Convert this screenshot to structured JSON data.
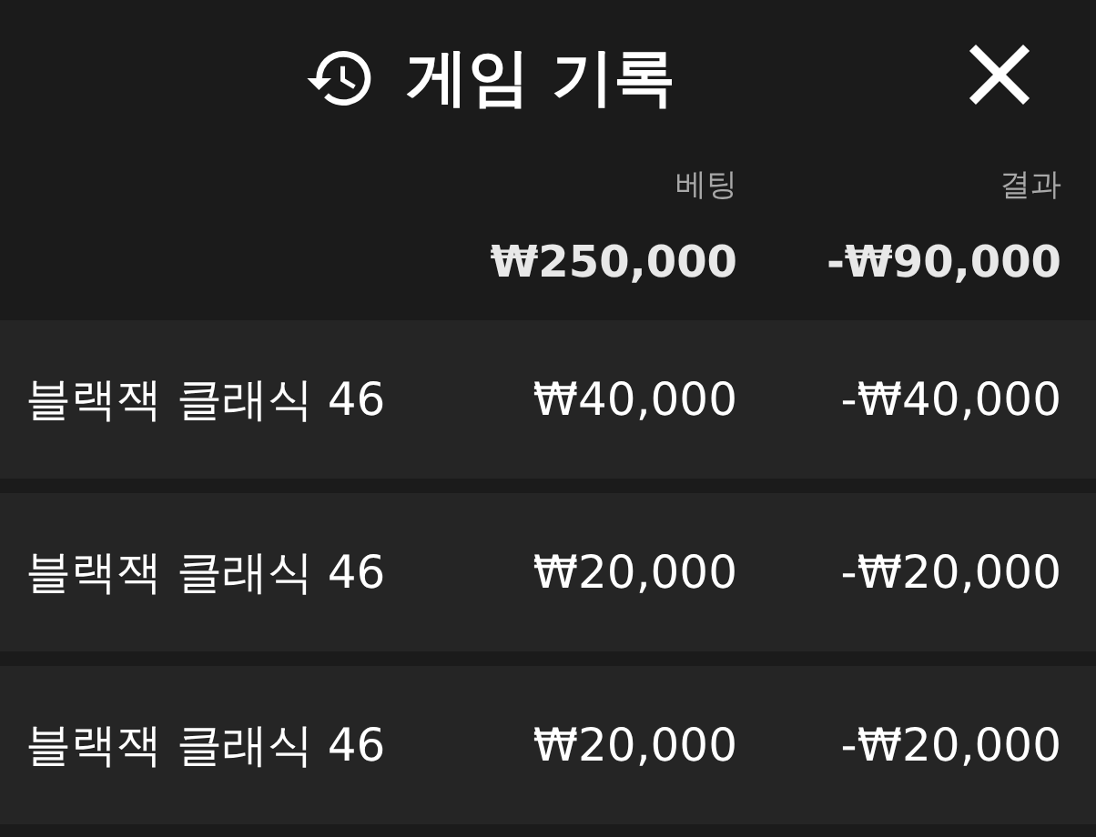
{
  "header": {
    "title": "게임 기록"
  },
  "columns": {
    "bet": "베팅",
    "result": "결과"
  },
  "totals": {
    "bet": "₩250,000",
    "result": "-₩90,000"
  },
  "rows": [
    {
      "game": "블랙잭 클래식 46",
      "bet": "₩40,000",
      "result": "-₩40,000"
    },
    {
      "game": "블랙잭 클래식 46",
      "bet": "₩20,000",
      "result": "-₩20,000"
    },
    {
      "game": "블랙잭 클래식 46",
      "bet": "₩20,000",
      "result": "-₩20,000"
    }
  ]
}
